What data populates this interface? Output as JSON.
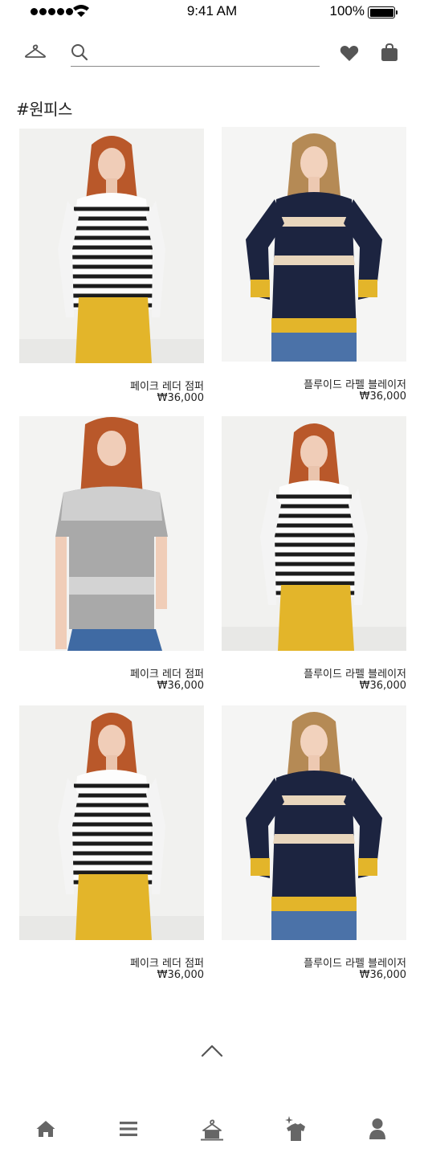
{
  "status_bar": {
    "time": "9:41 AM",
    "battery": "100%",
    "icons": [
      "signal-dots-icon",
      "wifi-icon",
      "battery-icon"
    ]
  },
  "header": {
    "icons": [
      "hanger-icon",
      "search-icon",
      "heart-icon",
      "shopping-bag-icon"
    ],
    "search": {
      "value": "",
      "placeholder": ""
    }
  },
  "category": {
    "title": "#원피스"
  },
  "products": [
    {
      "name": "페이크 레더 점퍼",
      "price": "₩36,000",
      "image": "striped-top-yellow-skirt"
    },
    {
      "name": "플루이드 라펠 블레이저",
      "price": "₩36,000",
      "image": "navy-stripe-sweater-jeans"
    },
    {
      "name": "페이크 레더 점퍼",
      "price": "₩36,000",
      "image": "grey-lace-tee-jeans"
    },
    {
      "name": "플루이드 라펠 블레이저",
      "price": "₩36,000",
      "image": "striped-top-yellow-skirt"
    },
    {
      "name": "페이크 레더 점퍼",
      "price": "₩36,000",
      "image": "striped-top-yellow-skirt"
    },
    {
      "name": "플루이드 라펠 블레이저",
      "price": "₩36,000",
      "image": "navy-stripe-sweater-jeans"
    }
  ],
  "scroll_top": {
    "icon": "chevron-up-icon"
  },
  "tab_bar": {
    "items": [
      {
        "icon": "home-icon"
      },
      {
        "icon": "menu-icon"
      },
      {
        "icon": "hanger-rack-icon"
      },
      {
        "icon": "sparkle-shirt-icon"
      },
      {
        "icon": "user-icon"
      }
    ]
  },
  "colors": {
    "icon_grey": "#555555",
    "tab_grey": "#666666",
    "text": "#222222",
    "search_underline": "#8a8a8a",
    "skirt_yellow": "#e3b52a",
    "navy": "#1c2440",
    "denim": "#4b72a8",
    "hair": "#b9582a",
    "hair_blonde": "#b58a55"
  }
}
